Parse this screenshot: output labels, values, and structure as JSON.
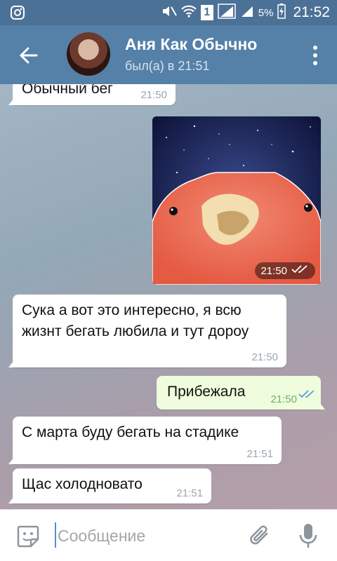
{
  "status_bar": {
    "battery_percent": "5%",
    "time": "21:52",
    "sim_label": "1"
  },
  "header": {
    "name": "Аня Как Обычно",
    "status": "был(а) в 21:51"
  },
  "messages": [
    {
      "text": "Обычный бег",
      "time": "21:50"
    },
    {
      "type": "photo",
      "time": "21:50"
    },
    {
      "text": "Сука а вот это интересно, я всю жизнт бегать любила и тут дороу",
      "time": "21:50"
    },
    {
      "text": "Прибежала",
      "time": "21:50"
    },
    {
      "text": "С марта буду бегать на стадике",
      "time": "21:51"
    },
    {
      "text": "Щас холодновато",
      "time": "21:51"
    }
  ],
  "input": {
    "placeholder": "Сообщение"
  },
  "colors": {
    "header": "#5580a8",
    "status_bar": "#4c7196",
    "outgoing_bubble": "#effdde",
    "check_read": "#5aa0e0"
  }
}
